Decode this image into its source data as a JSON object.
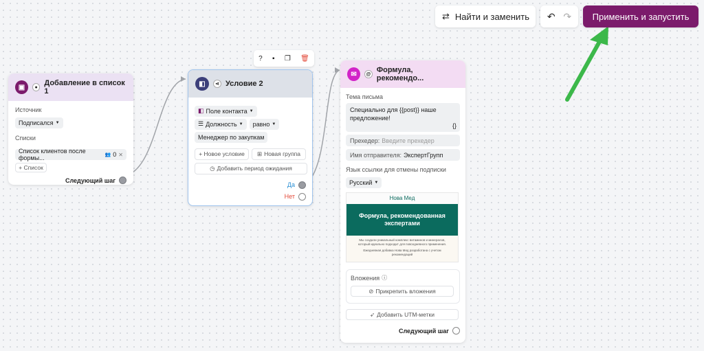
{
  "toolbar": {
    "find_replace_label": "Найти и заменить",
    "apply_run_label": "Применить и запустить",
    "run_color": "#7b1b6b"
  },
  "card1": {
    "title": "Добавление в список 1",
    "source_label": "Источник",
    "source_value": "Подписался",
    "lists_label": "Списки",
    "list_value": "Список клиентов после формы...",
    "list_count": "0",
    "add_list_label": "+ Список",
    "next_step_label": "Следующий шаг"
  },
  "card2": {
    "title": "Условие 2",
    "contact_field": "Поле контакта",
    "position_field": "Должность",
    "operator": "равно",
    "value": "Менеджер по закупкам",
    "new_condition": "+ Новое условие",
    "new_group": "Новая группа",
    "add_wait": "Добавить период ожидания",
    "yes_label": "Да",
    "no_label": "Нет"
  },
  "card3": {
    "title": "Формула, рекомендо...",
    "subject_label": "Тема письма",
    "subject_value": "Специально для {{post}} наше предложение!",
    "braces": "{}",
    "preheader_label": "Прехедер:",
    "preheader_placeholder": "Введите прехедер",
    "sender_label": "Имя отправителя:",
    "sender_value": "ЭкспертГрупп",
    "unsub_lang_label": "Язык ссылки для отмены подписки",
    "lang_value": "Русский",
    "preview_brand": "Нова Мед",
    "preview_headline": "Формула, рекомендованная экспертами",
    "preview_text1": "Мы создали уникальный комплекс витаминов и минералов, который идеально подходит для повседневного применения.",
    "preview_text2": "Ежедневная добавка Нова Мед разработана с учетом рекомендаций",
    "attachments_label": "Вложения",
    "attach_button": "Прикрепить вложения",
    "utm_button": "Добавить UTM-метки",
    "next_step_label": "Следующий шаг"
  }
}
